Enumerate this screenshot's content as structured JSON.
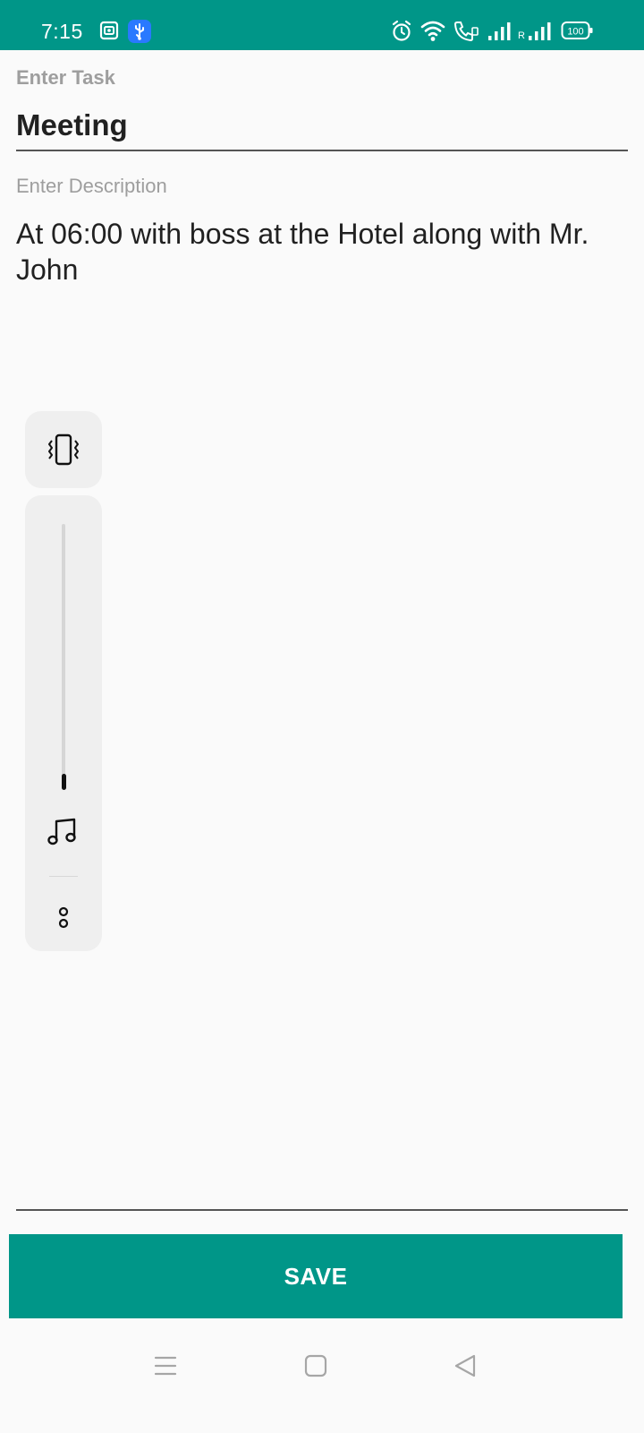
{
  "status_bar": {
    "time": "7:15",
    "battery_level": "100",
    "roaming_label": "R",
    "background_color": "#009688",
    "left_icons": [
      "screen-recorder-icon",
      "usb-debugging-icon"
    ],
    "right_icons": [
      "alarm-icon",
      "wifi-icon",
      "volte-call-icon",
      "signal-icon",
      "roaming-signal-icon",
      "battery-icon"
    ]
  },
  "form": {
    "task_label": "Enter Task",
    "task_value": "Meeting",
    "description_label": "Enter Description",
    "description_value": "At 06:00 with boss at the Hotel along with Mr. John"
  },
  "volume_panel": {
    "mode_icon": "vibrate-icon",
    "stream_icon": "music-note-icon",
    "more_icon": "more-options-icon",
    "media_volume_level": 0.05
  },
  "actions": {
    "save_label": "SAVE",
    "accent_color": "#009688"
  },
  "nav_bar": {
    "icons": [
      "menu-icon",
      "home-icon",
      "back-icon"
    ]
  }
}
